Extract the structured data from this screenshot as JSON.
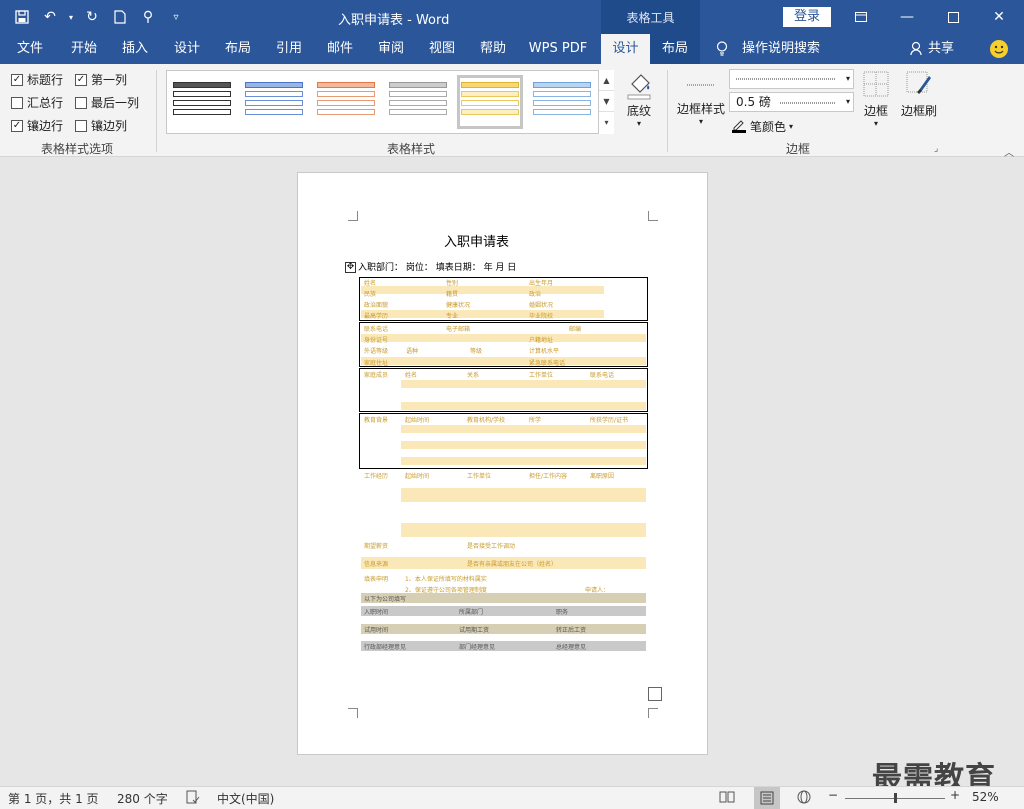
{
  "window": {
    "title": "入职申请表  -  Word",
    "context_tools": "表格工具",
    "login": "登录"
  },
  "tabs": [
    {
      "label": "文件"
    },
    {
      "label": "开始"
    },
    {
      "label": "插入"
    },
    {
      "label": "设计"
    },
    {
      "label": "布局"
    },
    {
      "label": "引用"
    },
    {
      "label": "邮件"
    },
    {
      "label": "审阅"
    },
    {
      "label": "视图"
    },
    {
      "label": "帮助"
    },
    {
      "label": "WPS PDF"
    },
    {
      "label": "设计"
    },
    {
      "label": "布局"
    }
  ],
  "tell_me": "操作说明搜索",
  "share": "共享",
  "ribbon": {
    "style_options": {
      "group_label": "表格样式选项",
      "items": [
        {
          "label": "标题行",
          "checked": "✓"
        },
        {
          "label": "第一列",
          "checked": "✓"
        },
        {
          "label": "汇总行",
          "checked": ""
        },
        {
          "label": "最后一列",
          "checked": ""
        },
        {
          "label": "镶边行",
          "checked": "✓"
        },
        {
          "label": "镶边列",
          "checked": ""
        }
      ]
    },
    "table_styles": {
      "group_label": "表格样式",
      "shading": "底纹"
    },
    "borders": {
      "group_label": "边框",
      "border_styles": "边框样式",
      "weight": "0.5 磅",
      "pen_color": "笔颜色",
      "borders_btn": "边框",
      "painter_btn": "边框刷"
    },
    "colors": {
      "accent": "#2b579a"
    }
  },
  "document": {
    "form_title": "入职申请表",
    "meta": "入职部门：    岗位：    填表日期：    年     月     日",
    "sec1": [
      [
        "姓名",
        "性别",
        "出生年月"
      ],
      [
        "民族",
        "籍贯",
        "政治"
      ],
      [
        "政治面貌",
        "健康状况",
        "婚姻状况"
      ],
      [
        "最高学历",
        "专业",
        "毕业院校"
      ]
    ],
    "sec2": [
      [
        "联系电话",
        "电子邮箱",
        "邮编"
      ],
      [
        "身份证号",
        "户籍地址"
      ],
      [
        "外语等级",
        "语种",
        "等级",
        "计算机水平"
      ],
      [
        "家庭住址",
        "紧急联系电话"
      ]
    ],
    "family_header": [
      "家庭成员",
      "姓名",
      "关系",
      "工作单位",
      "联系电话"
    ],
    "edu_header": [
      "教育背景",
      "起始时间",
      "教育机构/学校",
      "所学",
      "所获学历/证书"
    ],
    "work_header": [
      "工作经历",
      "起始时间",
      "工作单位",
      "担任/工作内容",
      "离职原因"
    ],
    "salary_row": [
      "期望薪资",
      "是否接受工作调动"
    ],
    "source_row": [
      "信息来源",
      "是否有亲属或朋友在公司（姓名）"
    ],
    "declare_label": "填表申明",
    "declare_1": "1、本人保证所填写的材料属实",
    "declare_2": "2、保证遵守公司各项管理制度",
    "applicant": "申请人：",
    "company_fill": "以下为公司填写",
    "row_a": [
      "入职时间",
      "所属部门",
      "职务"
    ],
    "row_b": [
      "试用时间",
      "试用期工资",
      "转正后工资"
    ],
    "row_c": [
      "行政部经理意见",
      "部门经理意见",
      "总经理意见"
    ]
  },
  "watermark": "最需教育",
  "status": {
    "page": "第 1 页，共 1 页",
    "words": "280 个字",
    "lang": "中文(中国)",
    "zoom": "52%"
  }
}
